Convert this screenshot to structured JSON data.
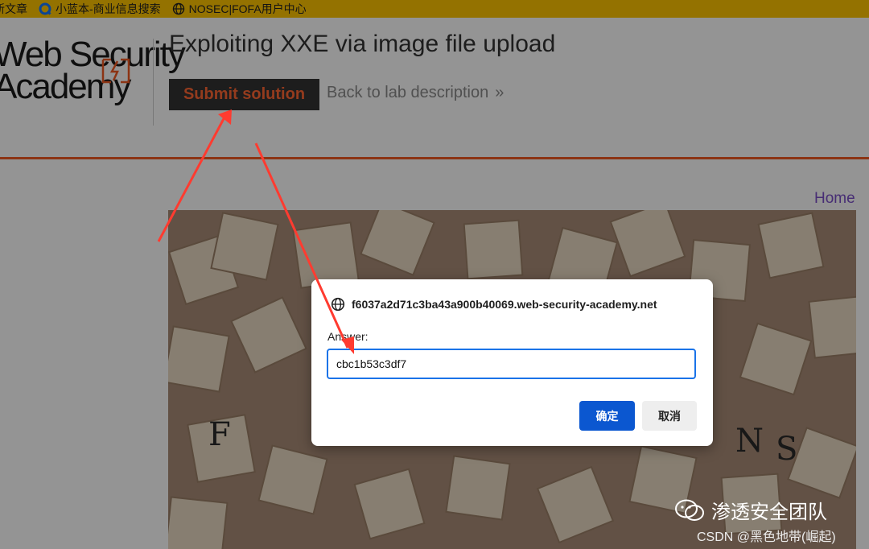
{
  "bookmarks": [
    {
      "label": "新文章",
      "icon": "none"
    },
    {
      "label": "小蓝本-商业信息搜索",
      "icon": "blue-q-icon"
    },
    {
      "label": "NOSEC|FOFA用户中心",
      "icon": "globe-icon"
    }
  ],
  "header": {
    "logo_line1": "Web Security",
    "logo_line2": "Academy",
    "lab_title": "Exploiting XXE via image file upload",
    "submit_label": "Submit solution",
    "back_label": "Back to lab description",
    "back_chevron": "»",
    "home_label": "Home"
  },
  "colors": {
    "bookmarks_bg": "#ffc400",
    "accent_orange": "#f15a24",
    "submit_bg": "#333333",
    "dialog_primary": "#0b57d0",
    "arrow": "#ff3b30"
  },
  "dialog": {
    "origin": "f6037a2d71c3ba43a900b40069.web-security-academy.net",
    "label": "Answer:",
    "value": "cbc1b53c3df7",
    "ok_label": "确定",
    "cancel_label": "取消"
  },
  "watermark": {
    "main": "渗透安全团队",
    "sub": "CSDN @黑色地带(崛起)"
  }
}
